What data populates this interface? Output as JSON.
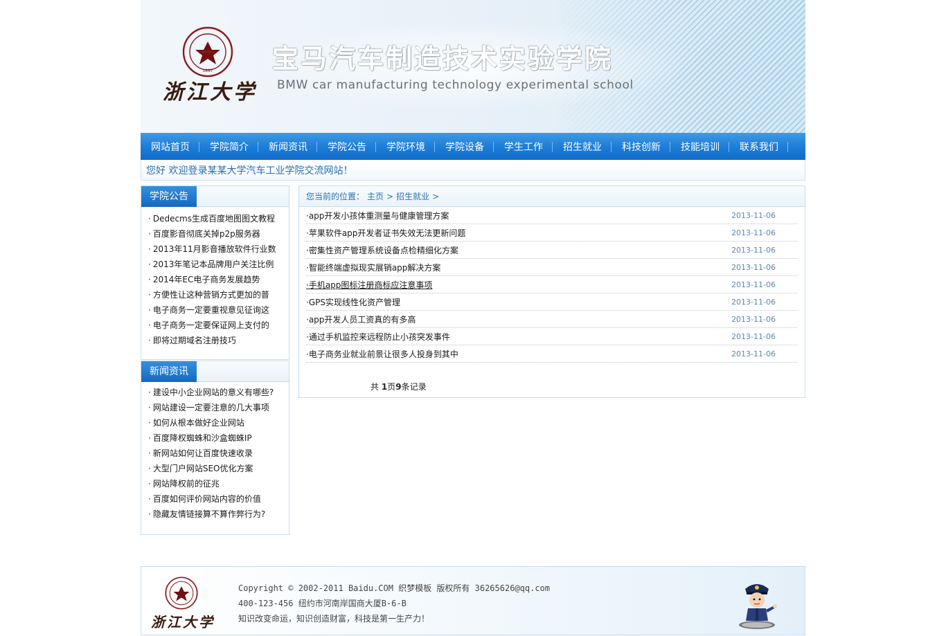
{
  "header": {
    "university_name": "浙江大学",
    "school_name_cn": "宝马汽车制造技术实验学院",
    "school_name_en": "BMW car manufacturing technology experimental school",
    "seal_text": "ZHEJIANG UNIVERSITY 1897"
  },
  "nav": {
    "items": [
      {
        "label": "网站首页"
      },
      {
        "label": "学院简介"
      },
      {
        "label": "新闻资讯"
      },
      {
        "label": "学院公告"
      },
      {
        "label": "学院环境"
      },
      {
        "label": "学院设备"
      },
      {
        "label": "学生工作"
      },
      {
        "label": "招生就业"
      },
      {
        "label": "科技创新"
      },
      {
        "label": "技能培训"
      },
      {
        "label": "联系我们"
      }
    ]
  },
  "welcome": "您好 欢迎登录某某大学汽车工业学院交流网站！",
  "sidebar": {
    "notices": {
      "title": "学院公告",
      "items": [
        "Dedecms生成百度地图图文教程",
        "百度影音彻底关掉p2p服务器",
        "2013年11月影音播放软件行业数",
        "2013年笔记本品牌用户关注比例",
        "2014年EC电子商务发展趋势",
        "方便性让这种营销方式更加的普",
        "电子商务一定要重视意见征询这",
        "电子商务一定要保证网上支付的",
        "即将过期域名注册技巧"
      ]
    },
    "news": {
      "title": "新闻资讯",
      "items": [
        "建设中小企业网站的意义有哪些?",
        "网站建设一定要注意的几大事项",
        "如何从根本做好企业网站",
        "百度降权蜘蛛和沙盒蜘蛛IP",
        "新网站如何让百度快速收录",
        "大型门户网站SEO优化方案",
        "网站降权前的征兆",
        "百度如何评价网站内容的价值",
        "隐藏友情链接算不算作弊行为?"
      ]
    }
  },
  "main": {
    "breadcrumb": {
      "prefix": "您当前的位置：",
      "home": "主页",
      "sep": ">",
      "current": "招生就业"
    },
    "articles": [
      {
        "title": "app开发小孩体重测量与健康管理方案",
        "date": "2013-11-06"
      },
      {
        "title": "苹果软件app开发者证书失效无法更新问题",
        "date": "2013-11-06"
      },
      {
        "title": "密集性资产管理系统设备点检精细化方案",
        "date": "2013-11-06"
      },
      {
        "title": "智能终端虚拟现实展销app解决方案",
        "date": "2013-11-06"
      },
      {
        "title": "手机app图标注册商标应注意事项",
        "date": "2013-11-06"
      },
      {
        "title": "GPS实现线性化资产管理",
        "date": "2013-11-06"
      },
      {
        "title": "app开发人员工资真的有多高",
        "date": "2013-11-06"
      },
      {
        "title": "通过手机监控来远程防止小孩突发事件",
        "date": "2013-11-06"
      },
      {
        "title": "电子商务业就业前景让很多人投身到其中",
        "date": "2013-11-06"
      }
    ],
    "pager": {
      "prefix": "共",
      "pages": "1",
      "mid": "页",
      "records": "9",
      "suffix": "条记录"
    }
  },
  "footer": {
    "university_name": "浙江大学",
    "lines": [
      "Copyright © 2002-2011 Baidu.COM 织梦模板 版权所有 36265626@qq.com",
      "400-123-456 纽约市河南岸国商大厦B-6-B",
      "知识改变命运，知识创造财富，科技是第一生产力！"
    ]
  },
  "colors": {
    "nav_blue": "#1e7ed8",
    "link_blue": "#2b6fb3",
    "date_blue": "#5a86b6",
    "border": "#c7dcec"
  }
}
